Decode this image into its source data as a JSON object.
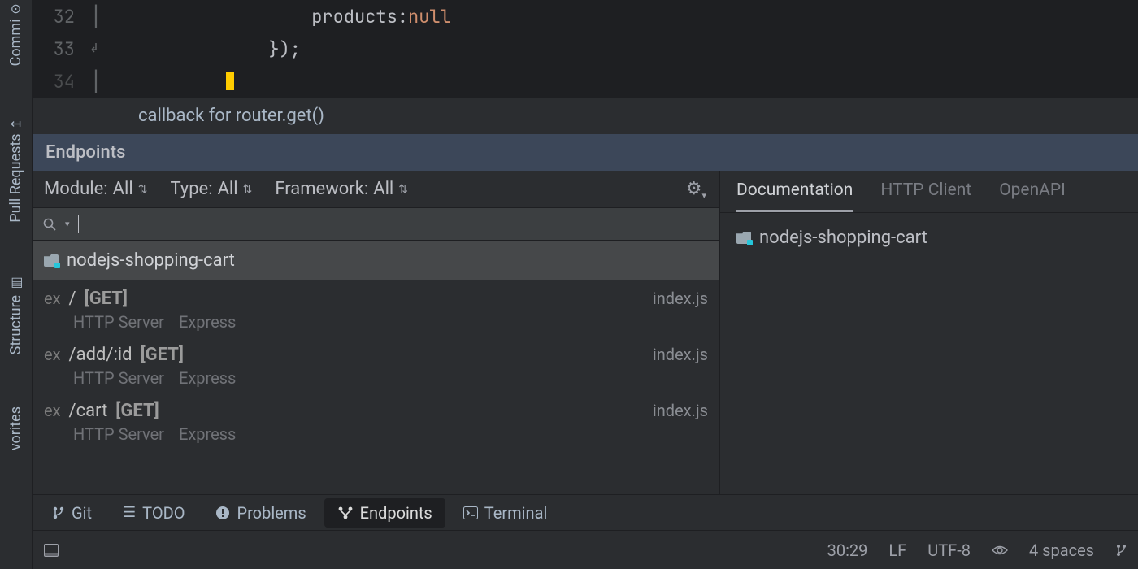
{
  "left_rail": {
    "items": [
      {
        "label": "Commi",
        "icon": "commit"
      },
      {
        "label": "Pull Requests",
        "icon": "pull-request"
      },
      {
        "label": "Structure",
        "icon": "structure"
      },
      {
        "label": "vorites",
        "icon": "favorites"
      }
    ]
  },
  "editor": {
    "lines": [
      {
        "num": "32",
        "indent": "                ",
        "text_before": "products: ",
        "keyword": "null"
      },
      {
        "num": "33",
        "indent": "            ",
        "text_before": "});",
        "keyword": ""
      }
    ],
    "banner": "callback for router.get()"
  },
  "toolwindow_title": "Endpoints",
  "filters": {
    "module_label": "Module:",
    "module_value": "All",
    "type_label": "Type:",
    "type_value": "All",
    "framework_label": "Framework:",
    "framework_value": "All"
  },
  "search": {
    "placeholder": ""
  },
  "project_name": "nodejs-shopping-cart",
  "endpoints": [
    {
      "ex": "ex",
      "path": "/",
      "method": "[GET]",
      "file": "index.js",
      "server": "HTTP Server",
      "fw": "Express"
    },
    {
      "ex": "ex",
      "path": "/add/:id",
      "method": "[GET]",
      "file": "index.js",
      "server": "HTTP Server",
      "fw": "Express"
    },
    {
      "ex": "ex",
      "path": "/cart",
      "method": "[GET]",
      "file": "index.js",
      "server": "HTTP Server",
      "fw": "Express"
    }
  ],
  "doc_tabs": [
    "Documentation",
    "HTTP Client",
    "OpenAPI"
  ],
  "doc_active_project": "nodejs-shopping-cart",
  "bottom_tools": [
    {
      "label": "Git",
      "icon": "branch"
    },
    {
      "label": "TODO",
      "icon": "list"
    },
    {
      "label": "Problems",
      "icon": "warning"
    },
    {
      "label": "Endpoints",
      "icon": "endpoints",
      "active": true
    },
    {
      "label": "Terminal",
      "icon": "terminal"
    }
  ],
  "status": {
    "caret": "30:29",
    "line_sep": "LF",
    "encoding": "UTF-8",
    "indent": "4 spaces"
  }
}
